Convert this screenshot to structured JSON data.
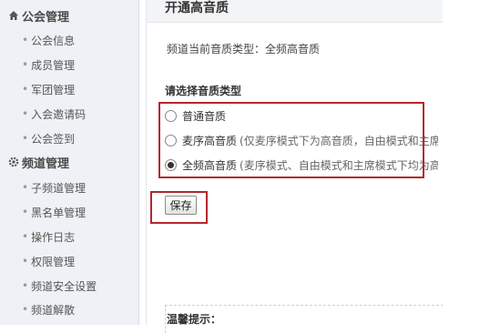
{
  "sidebar": {
    "guild_section": {
      "label": "公会管理",
      "icon": "home-icon"
    },
    "guild_items": [
      {
        "label": "公会信息"
      },
      {
        "label": "成员管理"
      },
      {
        "label": "军团管理"
      },
      {
        "label": "入会邀请码"
      },
      {
        "label": "公会签到"
      }
    ],
    "channel_section": {
      "label": "频道管理",
      "icon": "gear-icon"
    },
    "channel_items": [
      {
        "label": "子频道管理"
      },
      {
        "label": "黑名单管理"
      },
      {
        "label": "操作日志"
      },
      {
        "label": "权限管理"
      },
      {
        "label": "频道安全设置"
      },
      {
        "label": "频道解散"
      }
    ]
  },
  "main": {
    "title": "开通高音质",
    "current_quality_label": "频道当前音质类型：",
    "current_quality_value": "全频高音质",
    "choose_label": "请选择音质类型",
    "options": [
      {
        "name": "普通音质",
        "note": "",
        "checked": false
      },
      {
        "name": "麦序高音质",
        "note": "(仅麦序模式下为高音质，自由模式和主席模",
        "checked": false
      },
      {
        "name": "全频高音质",
        "note": "(麦序模式、自由模式和主席模式下均为高音",
        "checked": true
      }
    ],
    "save_label": "保存",
    "tip_title": "温馨提示："
  },
  "colors": {
    "highlight": "#b3282d",
    "sidebar_bg": "#eef1f5"
  }
}
